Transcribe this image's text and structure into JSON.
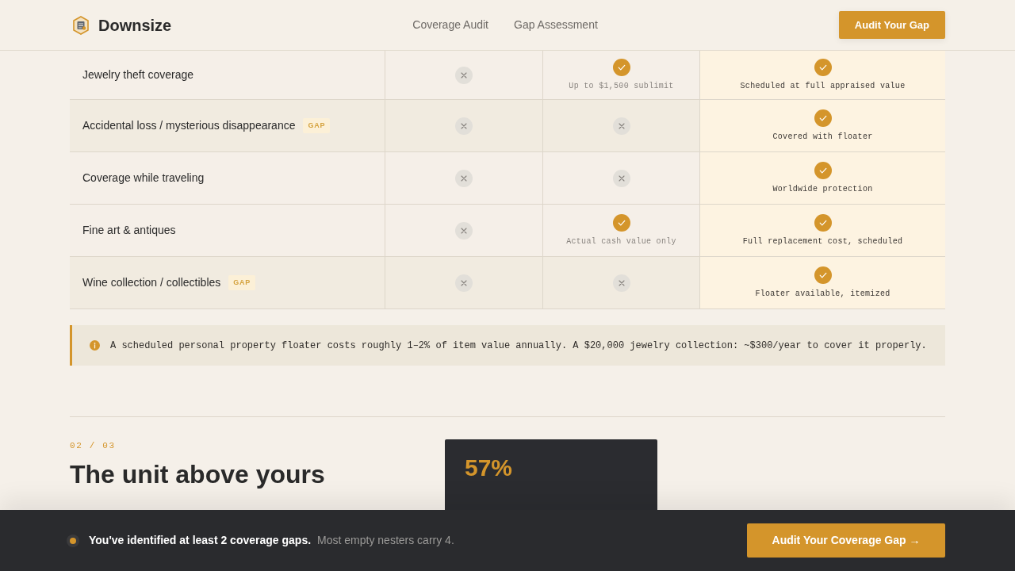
{
  "header": {
    "brand": "Downsize",
    "nav": [
      {
        "label": "Coverage Audit"
      },
      {
        "label": "Gap Assessment"
      }
    ],
    "cta": "Audit Your Gap"
  },
  "comparison_table": {
    "rows": [
      {
        "feature": "Jewelry theft coverage",
        "cells": [
          {
            "covered": false
          },
          {
            "covered": true,
            "note": "Up to $1,500 sublimit"
          },
          {
            "covered": true,
            "note": "Scheduled at full appraised value"
          }
        ]
      },
      {
        "feature": "Accidental loss / mysterious disappearance",
        "badge": "GAP",
        "cells": [
          {
            "covered": false
          },
          {
            "covered": false
          },
          {
            "covered": true,
            "note": "Covered with floater"
          }
        ]
      },
      {
        "feature": "Coverage while traveling",
        "cells": [
          {
            "covered": false
          },
          {
            "covered": false
          },
          {
            "covered": true,
            "note": "Worldwide protection"
          }
        ]
      },
      {
        "feature": "Fine art & antiques",
        "cells": [
          {
            "covered": false
          },
          {
            "covered": true,
            "note": "Actual cash value only"
          },
          {
            "covered": true,
            "note": "Full replacement cost, scheduled"
          }
        ]
      },
      {
        "feature": "Wine collection / collectibles",
        "badge": "GAP",
        "cells": [
          {
            "covered": false
          },
          {
            "covered": false
          },
          {
            "covered": true,
            "note": "Floater available, itemized"
          }
        ]
      }
    ]
  },
  "callout": {
    "text": "A scheduled personal property floater costs roughly 1–2% of item value annually. A $20,000 jewelry collection: ~$300/year to cover it properly."
  },
  "section": {
    "counter": "02 / 03",
    "heading": "The unit above yours",
    "stat": "57%"
  },
  "bottom_bar": {
    "message": "You've identified at least 2 coverage gaps.",
    "detail": "Most empty nesters carry 4.",
    "button": "Audit Your Coverage Gap →"
  }
}
